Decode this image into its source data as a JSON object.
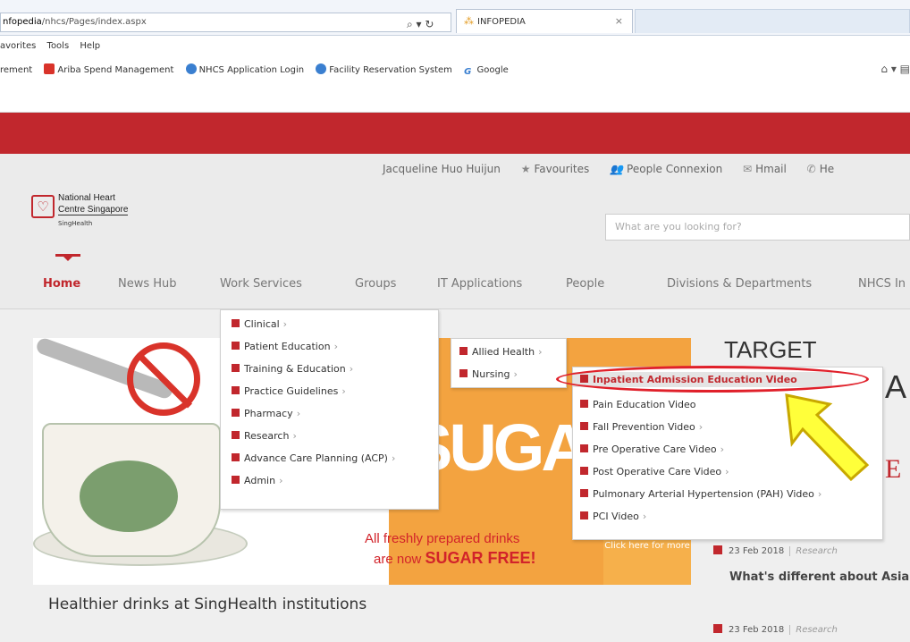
{
  "browser": {
    "address_url_bold": "nfopedia",
    "address_url_rest": "/nhcs/Pages/index.aspx",
    "address_tools": "⌕ ▾ ↻",
    "tab_title": "INFOPEDIA",
    "tab_close": "×",
    "menu": [
      "avorites",
      "Tools",
      "Help"
    ],
    "favorites": [
      "rement",
      "Ariba Spend Management",
      "NHCS Application Login",
      "Facility Reservation System",
      "Google"
    ],
    "google_glyph": "G",
    "right_tools": "⌂ ▾ ▤"
  },
  "site": {
    "top_links": [
      "Jacqueline Huo Huijun",
      "Favourites",
      "People Connexion",
      "Hmail",
      "He"
    ],
    "top_link_icons": [
      "★",
      "👥",
      "✉",
      "✆"
    ],
    "logo": {
      "line1": "National Heart",
      "line2": "Centre Singapore",
      "line3": "SingHealth",
      "mark": "♡"
    },
    "search_placeholder": "What are you looking for?",
    "nav": [
      "Home",
      "News Hub",
      "Work Services",
      "Groups",
      "IT Applications",
      "People",
      "Divisions & Departments",
      "NHCS In"
    ]
  },
  "menus": {
    "level1": [
      {
        "label": "Clinical",
        "arrow": "›"
      },
      {
        "label": "Patient Education",
        "arrow": "›"
      },
      {
        "label": "Training & Education",
        "arrow": "›"
      },
      {
        "label": "Practice Guidelines",
        "arrow": "›"
      },
      {
        "label": "Pharmacy",
        "arrow": "›"
      },
      {
        "label": "Research",
        "arrow": "›"
      },
      {
        "label": "Advance Care Planning (ACP)",
        "arrow": "›"
      },
      {
        "label": "Admin",
        "arrow": "›"
      }
    ],
    "level2": [
      {
        "label": "Allied Health",
        "arrow": "›"
      },
      {
        "label": "Nursing",
        "arrow": "›"
      }
    ],
    "level3": [
      {
        "label": "Inpatient Admission Education Video",
        "arrow": ""
      },
      {
        "label": "Pain Education Video",
        "arrow": ""
      },
      {
        "label": "Fall Prevention Video",
        "arrow": "›"
      },
      {
        "label": "Pre Operative Care Video",
        "arrow": "›"
      },
      {
        "label": "Post Operative Care Video",
        "arrow": "›"
      },
      {
        "label": "Pulmonary Arterial Hypertension (PAH) Video",
        "arrow": "›"
      },
      {
        "label": "PCI Video",
        "arrow": "›"
      }
    ]
  },
  "banner": {
    "big_text": "SUGA",
    "line1": "All freshly prepared drinks",
    "line2_prefix": "are now ",
    "line2_bold": "SUGAR FREE!",
    "cta": "Click here for more"
  },
  "headline": "Healthier drinks at SingHealth institutions",
  "right": {
    "target": "TARGET",
    "big_a": "A",
    "big_e": "E",
    "news": [
      {
        "date": "23 Feb 2018",
        "category": "Research",
        "title": "What's different about Asia"
      },
      {
        "date": "23 Feb 2018",
        "category": "Research"
      }
    ]
  },
  "annotation_colors": {
    "oval": "#e0202a",
    "arrow_fill": "#ffff3a",
    "arrow_stroke": "#c8a800"
  }
}
